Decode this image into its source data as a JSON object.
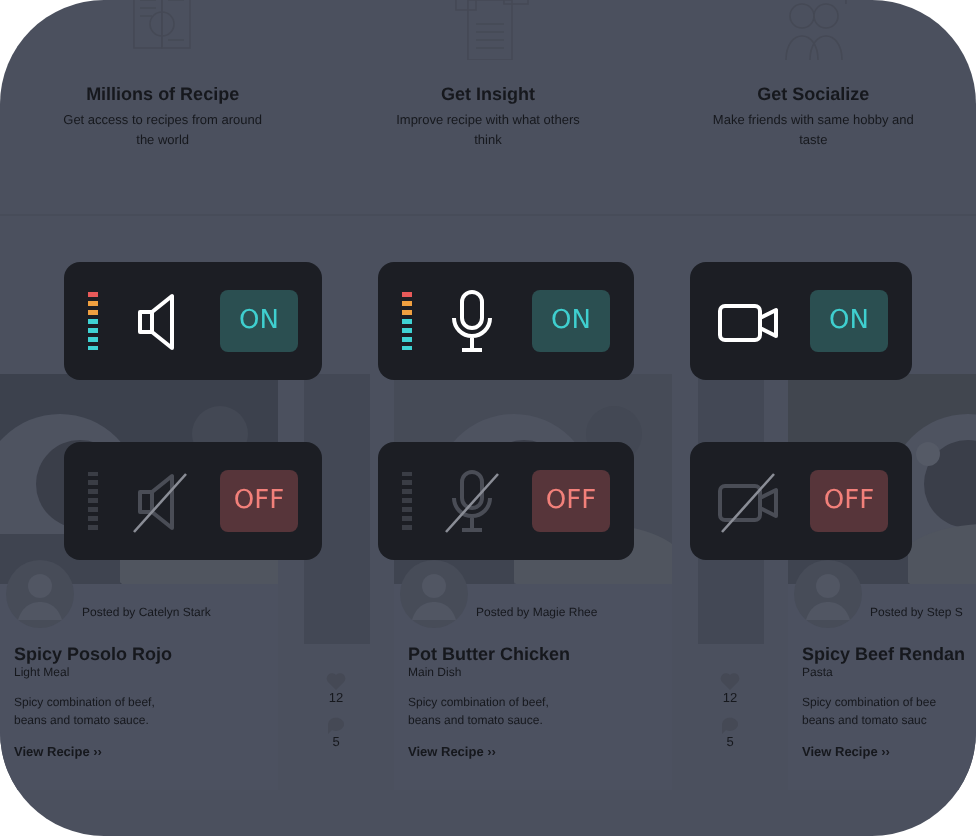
{
  "features": [
    {
      "title": "Millions of Recipe",
      "description": "Get access to recipes from around the world"
    },
    {
      "title": "Get Insight",
      "description": "Improve recipe with what others think"
    },
    {
      "title": "Get Socialize",
      "description": "Make friends with same hobby and taste"
    }
  ],
  "recipes": [
    {
      "posted_by": "Posted by Catelyn Stark",
      "title": "Spicy Posolo Rojo",
      "category": "Light Meal",
      "description_lines": [
        "Spicy combination of beef,",
        "beans and tomato sauce."
      ],
      "link": "View Recipe ››",
      "likes": "12",
      "comments": "5"
    },
    {
      "posted_by": "Posted by Magie Rhee",
      "title": "Pot Butter Chicken",
      "category": "Main Dish",
      "description_lines": [
        "Spicy combination of beef,",
        "beans and tomato sauce."
      ],
      "link": "View Recipe ››",
      "likes": "12",
      "comments": "5"
    },
    {
      "posted_by": "Posted by Step S",
      "title": "Spicy Beef Rendan",
      "category": "Pasta",
      "description_lines": [
        "Spicy combination of bee",
        "beans and tomato sauc"
      ],
      "link": "View Recipe ››"
    }
  ],
  "controls": [
    {
      "kind": "speaker",
      "on": true,
      "label": "ON",
      "level": 1
    },
    {
      "kind": "mic",
      "on": true,
      "label": "ON",
      "level": 1
    },
    {
      "kind": "camera",
      "on": true,
      "label": "ON"
    },
    {
      "kind": "speaker",
      "on": false,
      "label": "OFF"
    },
    {
      "kind": "mic",
      "on": false,
      "label": "OFF"
    },
    {
      "kind": "camera",
      "on": false,
      "label": "OFF"
    }
  ]
}
